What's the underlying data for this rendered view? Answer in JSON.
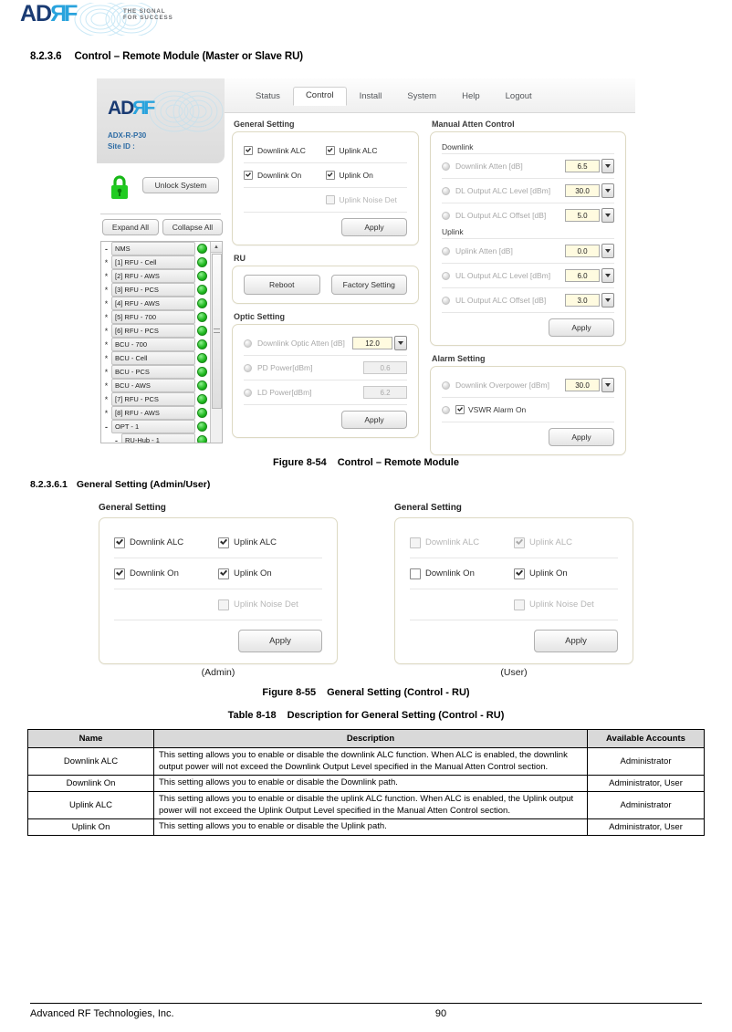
{
  "brand": {
    "logo_a": "AD",
    "logo_r": "R",
    "logo_f": "F",
    "tagline": "THE SIGNAL FOR SUCCESS"
  },
  "headings": {
    "section_number": "8.2.3.6",
    "section_title": "Control – Remote Module (Master or Slave RU)",
    "subsection_number": "8.2.3.6.1",
    "subsection_title": "General Setting (Admin/User)"
  },
  "captions": {
    "figure54_label": "Figure 8-54",
    "figure54_title": "Control – Remote Module",
    "figure55_label": "Figure 8-55",
    "figure55_title": "General Setting (Control - RU)",
    "table18_label": "Table 8-18",
    "table18_title": "Description for General Setting (Control - RU)",
    "admin_role": "(Admin)",
    "user_role": "(User)"
  },
  "device_ui": {
    "brand_model": "ADX-R-P30",
    "brand_site_id": "Site ID :",
    "menu": [
      {
        "label": "Status",
        "active": false
      },
      {
        "label": "Control",
        "active": true
      },
      {
        "label": "Install",
        "active": false
      },
      {
        "label": "System",
        "active": false
      },
      {
        "label": "Help",
        "active": false
      },
      {
        "label": "Logout",
        "active": false
      }
    ],
    "unlock_button": "Unlock System",
    "expand_all_button": "Expand All",
    "collapse_all_button": "Collapse All",
    "tree": [
      {
        "label": "NMS",
        "toggle": "-",
        "indent": 0,
        "star": false
      },
      {
        "label": "[1] RFU - Cell",
        "toggle": "",
        "indent": 0,
        "star": true
      },
      {
        "label": "[2] RFU - AWS",
        "toggle": "",
        "indent": 0,
        "star": true
      },
      {
        "label": "[3] RFU - PCS",
        "toggle": "",
        "indent": 0,
        "star": true
      },
      {
        "label": "[4] RFU - AWS",
        "toggle": "",
        "indent": 0,
        "star": true
      },
      {
        "label": "[5] RFU - 700",
        "toggle": "",
        "indent": 0,
        "star": true
      },
      {
        "label": "[6] RFU - PCS",
        "toggle": "",
        "indent": 0,
        "star": true
      },
      {
        "label": "BCU - 700",
        "toggle": "",
        "indent": 0,
        "star": true
      },
      {
        "label": "BCU - Cell",
        "toggle": "",
        "indent": 0,
        "star": true
      },
      {
        "label": "BCU - PCS",
        "toggle": "",
        "indent": 0,
        "star": true
      },
      {
        "label": "BCU - AWS",
        "toggle": "",
        "indent": 0,
        "star": true
      },
      {
        "label": "[7] RFU - PCS",
        "toggle": "",
        "indent": 0,
        "star": true
      },
      {
        "label": "[8] RFU - AWS",
        "toggle": "",
        "indent": 0,
        "star": true
      },
      {
        "label": "OPT - 1",
        "toggle": "-",
        "indent": 0,
        "star": false
      },
      {
        "label": "RU-Hub - 1",
        "toggle": "-",
        "indent": 1,
        "star": false
      }
    ],
    "general_setting": {
      "title": "General Setting",
      "items": [
        {
          "label": "Downlink ALC",
          "checked": true,
          "dim": false
        },
        {
          "label": "Uplink ALC",
          "checked": true,
          "dim": false
        },
        {
          "label": "Downlink On",
          "checked": true,
          "dim": false
        },
        {
          "label": "Uplink On",
          "checked": true,
          "dim": false
        },
        {
          "label": "Uplink Noise Det",
          "checked": false,
          "dim": true
        }
      ],
      "apply_label": "Apply"
    },
    "ru_section": {
      "title": "RU",
      "reboot_label": "Reboot",
      "factory_label": "Factory Setting"
    },
    "optic_setting": {
      "title": "Optic Setting",
      "rows": [
        {
          "label": "Downlink Optic Atten [dB]",
          "value": "12.0",
          "dropdown": true,
          "readonly": false
        },
        {
          "label": "PD Power[dBm]",
          "value": "0.6",
          "dropdown": false,
          "readonly": true
        },
        {
          "label": "LD Power[dBm]",
          "value": "6.2",
          "dropdown": false,
          "readonly": true
        }
      ],
      "apply_label": "Apply"
    },
    "manual_atten": {
      "title": "Manual Atten Control",
      "downlink_label": "Downlink",
      "uplink_label": "Uplink",
      "downlink_rows": [
        {
          "label": "Downlink Atten [dB]",
          "value": "6.5"
        },
        {
          "label": "DL Output ALC Level [dBm]",
          "value": "30.0"
        },
        {
          "label": "DL Output ALC Offset [dB]",
          "value": "5.0"
        }
      ],
      "uplink_rows": [
        {
          "label": "Uplink Atten [dB]",
          "value": "0.0"
        },
        {
          "label": "UL Output ALC Level [dBm]",
          "value": "6.0"
        },
        {
          "label": "UL Output ALC Offset [dB]",
          "value": "3.0"
        }
      ],
      "apply_label": "Apply"
    },
    "alarm_setting": {
      "title": "Alarm Setting",
      "overpower_label": "Downlink Overpower [dBm]",
      "overpower_value": "30.0",
      "vswr_label": "VSWR Alarm On",
      "vswr_checked": true,
      "apply_label": "Apply"
    }
  },
  "figure55": {
    "admin": {
      "title": "General Setting",
      "items": [
        {
          "label": "Downlink ALC",
          "checked": true,
          "dim": false
        },
        {
          "label": "Uplink ALC",
          "checked": true,
          "dim": false
        },
        {
          "label": "Downlink On",
          "checked": true,
          "dim": false
        },
        {
          "label": "Uplink On",
          "checked": true,
          "dim": false
        },
        {
          "label": "Uplink Noise Det",
          "checked": false,
          "dim": true
        }
      ],
      "apply_label": "Apply"
    },
    "user": {
      "title": "General Setting",
      "items": [
        {
          "label": "Downlink ALC",
          "checked": false,
          "dim": true
        },
        {
          "label": "Uplink ALC",
          "checked": true,
          "dim": true
        },
        {
          "label": "Downlink On",
          "checked": false,
          "dim": false
        },
        {
          "label": "Uplink On",
          "checked": true,
          "dim": false
        },
        {
          "label": "Uplink Noise Det",
          "checked": false,
          "dim": true
        }
      ],
      "apply_label": "Apply"
    }
  },
  "table": {
    "headers": [
      "Name",
      "Description",
      "Available Accounts"
    ],
    "rows": [
      {
        "name": "Downlink ALC",
        "description": "This setting allows you to enable or disable the downlink ALC function. When ALC is enabled, the downlink output power will not exceed the Downlink Output Level specified in the Manual Atten Control section.",
        "accounts": "Administrator"
      },
      {
        "name": "Downlink On",
        "description": "This setting allows you to enable or disable the Downlink path.",
        "accounts": "Administrator, User"
      },
      {
        "name": "Uplink ALC",
        "description": "This setting allows you to enable or disable the uplink ALC function. When ALC is enabled, the Uplink output power will not exceed the Uplink Output Level specified in the Manual Atten Control section.",
        "accounts": "Administrator"
      },
      {
        "name": "Uplink On",
        "description": "This setting allows you to enable or disable the Uplink path.",
        "accounts": "Administrator, User"
      }
    ]
  },
  "footer": {
    "company": "Advanced RF Technologies, Inc.",
    "page": "90"
  }
}
